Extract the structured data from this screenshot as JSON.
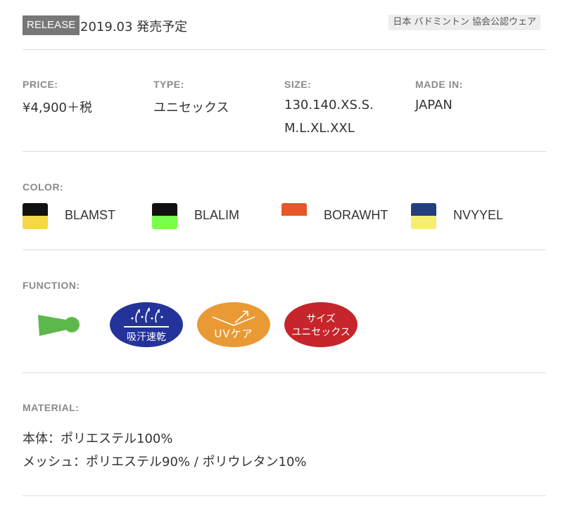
{
  "header": {
    "release_badge": "RELEASE",
    "release_date": "2019.03 発売予定",
    "official_tag": "日本 バドミントン 協会公認ウェア"
  },
  "specs": [
    {
      "label": "PRICE:",
      "lines": [
        "¥4,900＋税"
      ]
    },
    {
      "label": "TYPE:",
      "lines": [
        "ユニセックス"
      ]
    },
    {
      "label": "SIZE:",
      "lines": [
        "130.140.XS.S.",
        "M.L.XL.XXL"
      ]
    },
    {
      "label": "MADE IN:",
      "lines": [
        "JAPAN"
      ]
    }
  ],
  "color": {
    "label": "COLOR:",
    "items": [
      {
        "name": "BLAMST",
        "top": "#111111",
        "bottom": "#f5d84a"
      },
      {
        "name": "BLALIM",
        "top": "#111111",
        "bottom": "#79ff4a"
      },
      {
        "name": "BORAWHT",
        "top": "#e8562a",
        "bottom": "#ffffff"
      },
      {
        "name": "NVYYEL",
        "top": "#233f80",
        "bottom": "#f6ee72"
      }
    ]
  },
  "function": {
    "label": "FUNCTION:",
    "icons": [
      {
        "name": "shuttle-icon",
        "color": "#5cb84a"
      },
      {
        "name": "sweat-absorb-quick-dry-icon",
        "text": "吸汗速乾",
        "color": "#24339a"
      },
      {
        "name": "uv-care-icon",
        "text": "UVケア",
        "color": "#e99a35"
      },
      {
        "name": "size-unisex-icon",
        "text_line1": "サイズ",
        "text_line2": "ユニセックス",
        "color": "#c6252b"
      }
    ]
  },
  "material": {
    "label": "MATERIAL:",
    "lines": [
      "本体：ポリエステル100%",
      "メッシュ：ポリエステル90% / ポリウレタン10%"
    ]
  }
}
